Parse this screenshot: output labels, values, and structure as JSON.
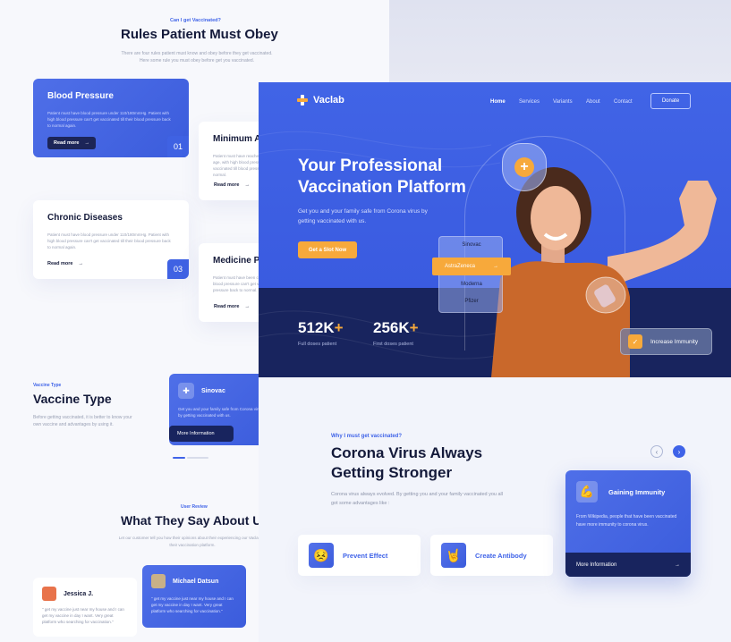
{
  "colors": {
    "primary": "#3f63e8",
    "accent": "#f7a93b",
    "navy": "#18245e",
    "bg": "#f2f4fb"
  },
  "back_page": {
    "rules": {
      "eyebrow": "Can I get Vaccinated?",
      "title": "Rules Patient Must Obey",
      "desc_line1": "There are four rules patient must know and obey before they get vaccinated.",
      "desc_line2": "Here some rule you must obey before get you vaccinated.",
      "cards": [
        {
          "title": "Blood Pressure",
          "desc": "Patient must have blood pressure under 110/180mmHg. Patient with high blood pressure can't get vaccinated till their blood pressure back to normal again.",
          "link": "Read more",
          "number": "01"
        },
        {
          "title": "Minimum A",
          "desc": "Patient must have reached the minimum age, with high blood pressure can't get vaccinated till blood pressure back to normal.",
          "link": "Read more"
        },
        {
          "title": "Chronic Diseases",
          "desc": "Patient must have blood pressure under 110/180mmHg. Patient with high blood pressure can't get vaccinated till their blood pressure back to normal again.",
          "link": "Read more",
          "number": "03"
        },
        {
          "title": "Medicine P",
          "desc": "Patient must have been consulted, with high blood pressure can't get vaccinated till blood pressure back to normal.",
          "link": "Read more"
        }
      ]
    },
    "vaccine_type": {
      "eyebrow": "Vaccine Type",
      "title": "Vaccine Type",
      "desc": "Before getting vaccinated, it is better to know your own vaccine and advantages by using it.",
      "card": {
        "icon": "syringe-icon",
        "title": "Sinovac",
        "desc": "Get you and your family safe from Corona virus by getting vaccinated with us.",
        "button": "More Information"
      }
    },
    "reviews": {
      "eyebrow": "User Review",
      "title": "What They Say About U",
      "desc": "Let our customer tell you how their opinions about their experiencing our Vaclab as their vaccination platform.",
      "items": [
        {
          "name": "Jessica J.",
          "quote": "\" get my vaccine just near my house and I can get my vaccine in day I want. Very great platform who searching for vaccination.\""
        },
        {
          "name": "Michael Datsun",
          "quote": "\" get my vaccine just near my house and I can get my vaccine in day I want. Very great platform who searching for vaccination.\""
        }
      ]
    }
  },
  "main": {
    "brand": "Vaclab",
    "nav": [
      "Home",
      "Services",
      "Variants",
      "About",
      "Contact"
    ],
    "donate": "Donate",
    "hero": {
      "title": "Your Professional Vaccination Platform",
      "subtitle": "Get you and your family safe from Corona virus by getting vaccinated with us.",
      "cta": "Get a Slot Now",
      "stats": [
        {
          "value": "512K",
          "plus": "+",
          "label": "Full doses patient"
        },
        {
          "value": "256K",
          "plus": "+",
          "label": "First doses patient"
        }
      ],
      "vaccine_options": [
        "Sinovac",
        "AstraZeneca",
        "Moderna",
        "Pfizer"
      ],
      "selected_vaccine": "AstraZeneca",
      "immunity_badge": "Increase Immunity"
    },
    "why": {
      "eyebrow": "Why I must get vaccinated?",
      "title": "Corona Virus Always Getting Stronger",
      "desc": "Corona virus always evolved. By getting you and your family vaccinated you all got some advantages like :",
      "benefits": [
        {
          "icon": "worried-face-icon",
          "label": "Prevent Effect"
        },
        {
          "icon": "rock-hand-icon",
          "label": "Create Antibody"
        }
      ],
      "feature_card": {
        "icon": "flexed-biceps-icon",
        "title": "Gaining Immunity",
        "desc": "From Wikipedia, people that have been vaccinated have more immunity to corona virus.",
        "button": "More Information"
      }
    }
  }
}
